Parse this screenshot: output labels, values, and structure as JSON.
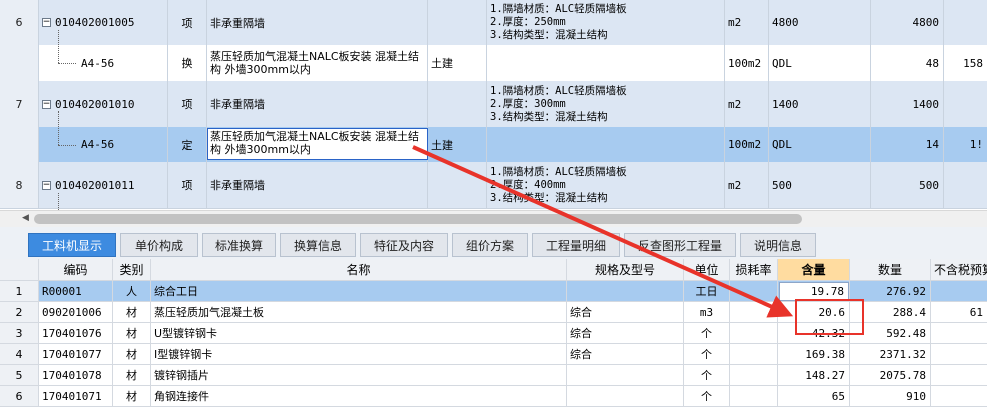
{
  "upper_grid": {
    "rows": [
      {
        "num": "6",
        "code": "010402001005",
        "type": "项",
        "name": "非承重隔墙",
        "major": "",
        "features": "1.隔墙材质：ALC轻质隔墙板\n2.厚度：250mm\n3.结构类型：混凝土结构",
        "unit": "m2",
        "expr": "4800",
        "qty": "4800",
        "extra": ""
      },
      {
        "num": "",
        "code": "A4-56",
        "type": "换",
        "name": "蒸压轻质加气混凝土NALC板安装 混凝土结构 外墙300mm以内",
        "major": "土建",
        "features": "",
        "unit": "100m2",
        "expr": "QDL",
        "qty": "48",
        "extra": "158"
      },
      {
        "num": "7",
        "code": "010402001010",
        "type": "项",
        "name": "非承重隔墙",
        "major": "",
        "features": "1.隔墙材质：ALC轻质隔墙板\n2.厚度：300mm\n3.结构类型：混凝土结构",
        "unit": "m2",
        "expr": "1400",
        "qty": "1400",
        "extra": ""
      },
      {
        "num": "",
        "code": "A4-56",
        "type": "定",
        "name": "蒸压轻质加气混凝土NALC板安装 混凝土结构 外墙300mm以内",
        "major": "土建",
        "features": "",
        "unit": "100m2",
        "expr": "QDL",
        "qty": "14",
        "extra": "1!"
      },
      {
        "num": "8",
        "code": "010402001011",
        "type": "项",
        "name": "非承重隔墙",
        "major": "",
        "features": "1.隔墙材质：ALC轻质隔墙板\n2.厚度：400mm\n3.结构类型：混凝土结构",
        "unit": "m2",
        "expr": "500",
        "qty": "500",
        "extra": ""
      }
    ]
  },
  "tabs": [
    {
      "label": "工料机显示"
    },
    {
      "label": "单价构成"
    },
    {
      "label": "标准换算"
    },
    {
      "label": "换算信息"
    },
    {
      "label": "特征及内容"
    },
    {
      "label": "组价方案"
    },
    {
      "label": "工程量明细"
    },
    {
      "label": "反查图形工程量"
    },
    {
      "label": "说明信息"
    }
  ],
  "lower_grid": {
    "headers": {
      "code": "编码",
      "category": "类别",
      "name": "名称",
      "spec": "规格及型号",
      "unit": "单位",
      "loss": "损耗率",
      "content": "含量",
      "qty": "数量",
      "price": "不含税预算"
    },
    "rows": [
      {
        "n": "1",
        "code": "R00001",
        "category": "人",
        "name": "综合工日",
        "spec": "",
        "unit": "工日",
        "loss": "",
        "content": "19.78",
        "qty": "276.92",
        "price": ""
      },
      {
        "n": "2",
        "code": "090201006",
        "category": "材",
        "name": "蒸压轻质加气混凝土板",
        "spec": "综合",
        "unit": "m3",
        "loss": "",
        "content": "20.6",
        "qty": "288.4",
        "price": "61"
      },
      {
        "n": "3",
        "code": "170401076",
        "category": "材",
        "name": "U型镀锌钢卡",
        "spec": "综合",
        "unit": "个",
        "loss": "",
        "content": "42.32",
        "qty": "592.48",
        "price": ""
      },
      {
        "n": "4",
        "code": "170401077",
        "category": "材",
        "name": "I型镀锌钢卡",
        "spec": "综合",
        "unit": "个",
        "loss": "",
        "content": "169.38",
        "qty": "2371.32",
        "price": ""
      },
      {
        "n": "5",
        "code": "170401078",
        "category": "材",
        "name": "镀锌钢插片",
        "spec": "",
        "unit": "个",
        "loss": "",
        "content": "148.27",
        "qty": "2075.78",
        "price": ""
      },
      {
        "n": "6",
        "code": "170401071",
        "category": "材",
        "name": "角钢连接件",
        "spec": "",
        "unit": "个",
        "loss": "",
        "content": "65",
        "qty": "910",
        "price": ""
      }
    ]
  },
  "colors": {
    "accent": "#3d8be0",
    "annotation": "#e8332a",
    "selected_row": "#a7cbf0",
    "highlight_header": "#ffdca0"
  },
  "icons": {
    "expander": "minus-box-icon",
    "arrow": "red-arrow-annotation",
    "scroll_left": "scroll-left-icon"
  }
}
